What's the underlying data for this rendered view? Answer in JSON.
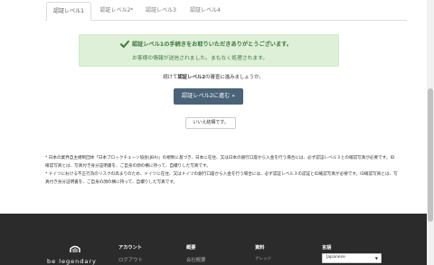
{
  "tabs": [
    {
      "label": "認証レベル1",
      "active": true
    },
    {
      "label": "認証レベル2*",
      "active": false
    },
    {
      "label": "認証レベル3",
      "active": false
    },
    {
      "label": "認証レベル4",
      "active": false
    }
  ],
  "alert": {
    "title": "認証レベル1の手続きをお取りいただきありがとうございます。",
    "message": "お客様の情報が送信されました。まもなく処理されます。",
    "icon": "checkmark-icon",
    "color": "#3c763d"
  },
  "prompt": {
    "prefix": "続けて",
    "bold": "認証レベル2",
    "suffix": "の審査に進みましょうか。"
  },
  "buttons": {
    "next": "認証レベル2に進む »",
    "decline": "いいえ結構です。"
  },
  "notes": [
    "* 日本の業界自主規制団体「日本ブロックチェーン協会(JBA)」の規制に基づき、日本に在住、又は日本の銀行口座から入金を行う場合には、必ず認証レベル３との確認写真が必要です。ID確認写真とは、写真付き身分証明書を、ご自身の顔の横に持って、自撮りした写真です。",
    "* ドイツにおける不正行為のリスクの高まりのため、ドイツに在住、又はドイツの銀行口座から入金を行う場合には、必ず認証レベル３の認証とID確認写真が必要です。ID確認写真とは、写真付き身分証明書を、ご自身の顔の横に持って、自撮りした写真です。"
  ],
  "footer": {
    "brand": "be legendary",
    "columns": [
      {
        "heading": "アカウント",
        "item": "ログアウト"
      },
      {
        "heading": "概要",
        "item": "会社概要"
      },
      {
        "heading": "資料",
        "item": "ナレッジ"
      },
      {
        "heading": "言語",
        "item": ""
      }
    ],
    "language_value": "Japanese"
  },
  "colors": {
    "primary_button": "#4a6378",
    "alert_bg": "#dff0d8",
    "footer_bg": "#2b2b2b"
  }
}
